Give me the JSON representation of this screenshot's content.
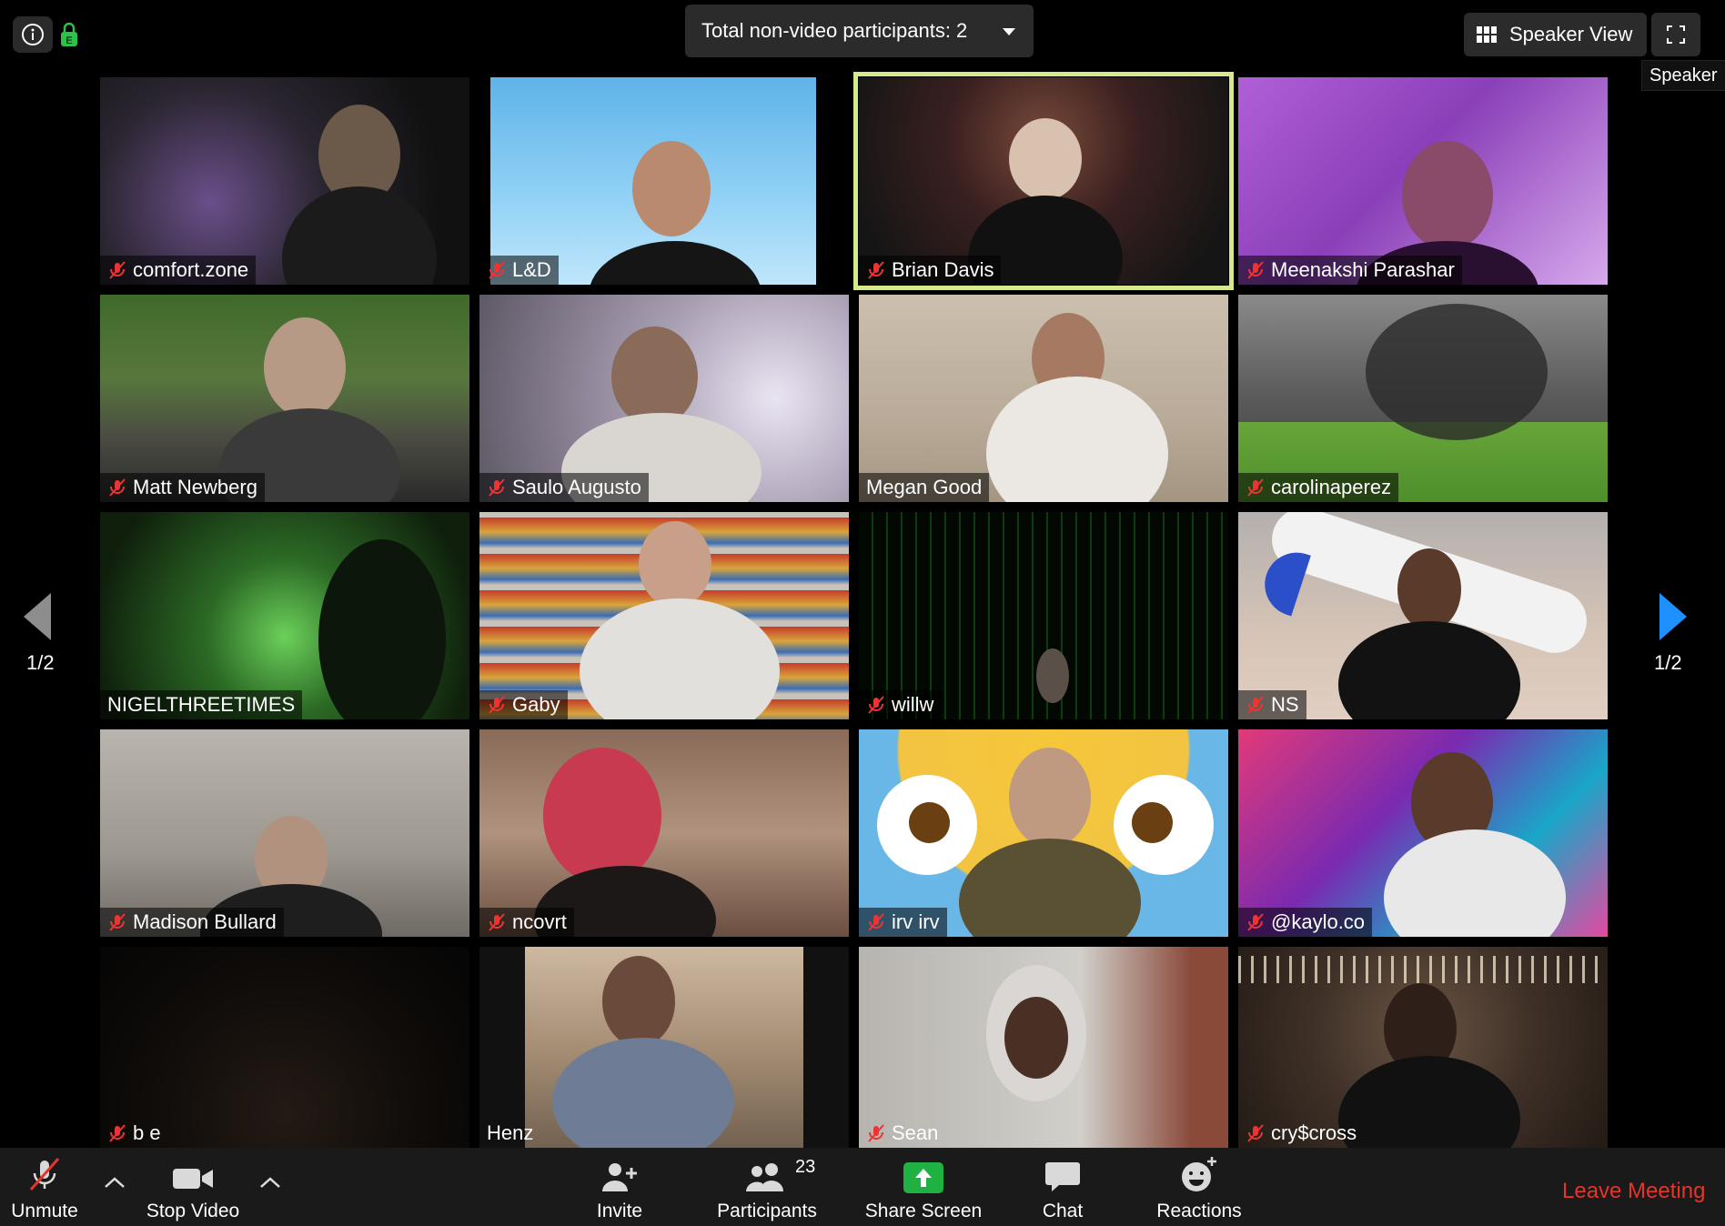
{
  "header": {
    "non_video_label": "Total non-video participants: 2",
    "speaker_view_label": "Speaker View",
    "tooltip": "Speaker"
  },
  "pagination": {
    "left": "1/2",
    "right": "1/2"
  },
  "tiles": [
    {
      "name": "comfort.zone",
      "muted": true
    },
    {
      "name": "L&D",
      "muted": true
    },
    {
      "name": "Brian Davis",
      "muted": true,
      "active": true
    },
    {
      "name": "Meenakshi Parashar",
      "muted": true
    },
    {
      "name": "Matt Newberg",
      "muted": true
    },
    {
      "name": "Saulo Augusto",
      "muted": true
    },
    {
      "name": "Megan Good",
      "muted": false
    },
    {
      "name": "carolinaperez",
      "muted": true
    },
    {
      "name": "NIGELTHREETIMES",
      "muted": false
    },
    {
      "name": "Gaby",
      "muted": true
    },
    {
      "name": "willw",
      "muted": true
    },
    {
      "name": "NS",
      "muted": true
    },
    {
      "name": "Madison Bullard",
      "muted": true
    },
    {
      "name": "ncovrt",
      "muted": true
    },
    {
      "name": "irv irv",
      "muted": true
    },
    {
      "name": "@kaylo.co",
      "muted": true
    },
    {
      "name": "b e",
      "muted": true
    },
    {
      "name": "Henz",
      "muted": false
    },
    {
      "name": "Sean",
      "muted": true
    },
    {
      "name": "cry$cross",
      "muted": true
    }
  ],
  "toolbar": {
    "unmute": "Unmute",
    "stop_video": "Stop Video",
    "invite": "Invite",
    "participants": "Participants",
    "participants_count": "23",
    "share_screen": "Share Screen",
    "chat": "Chat",
    "reactions": "Reactions",
    "leave": "Leave Meeting"
  },
  "colors": {
    "active_border": "#d6e98c",
    "leave_red": "#e5342b",
    "share_green": "#1fb141",
    "nav_blue": "#1e90ff"
  }
}
